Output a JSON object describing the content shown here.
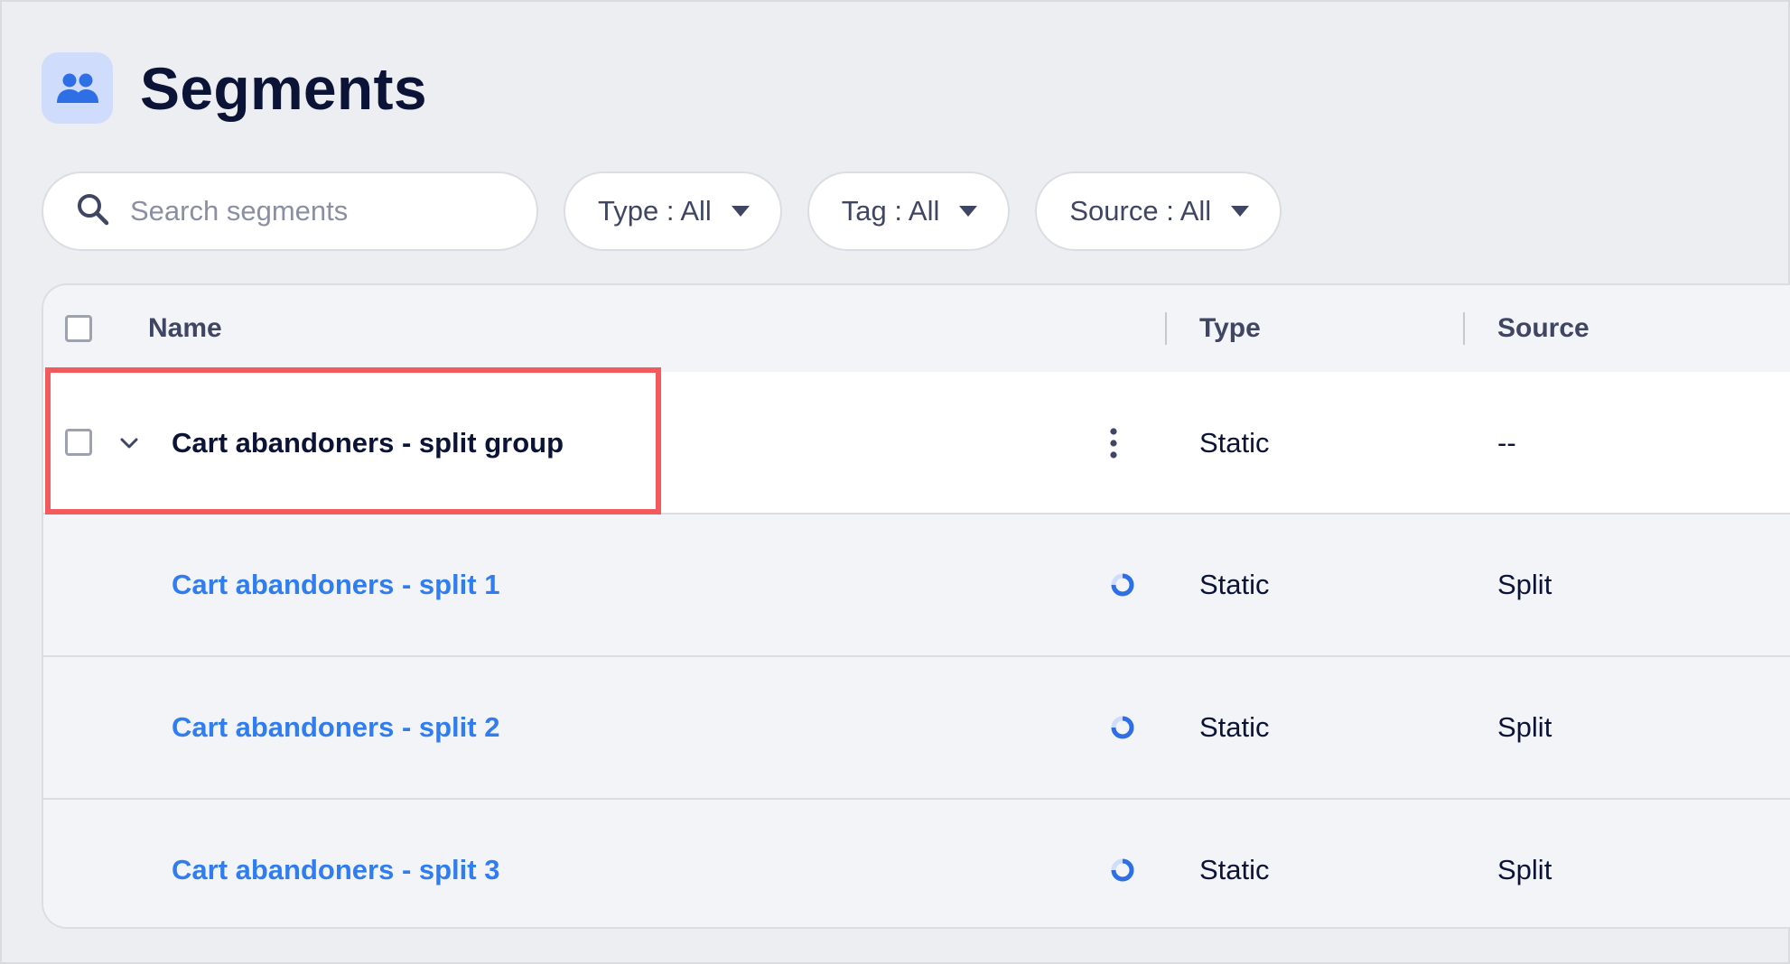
{
  "header": {
    "icon": "users-icon",
    "title": "Segments",
    "icon_bg": "#cfdcfb",
    "icon_color": "#2f6fe6"
  },
  "filters": {
    "search_placeholder": "Search segments",
    "type": {
      "label": "Type : All"
    },
    "tag": {
      "label": "Tag : All"
    },
    "source": {
      "label": "Source : All"
    }
  },
  "table": {
    "columns": {
      "name": "Name",
      "type": "Type",
      "source": "Source"
    },
    "group_row": {
      "name": "Cart abandoners - split group",
      "type": "Static",
      "source": "--"
    },
    "child_rows": [
      {
        "name": "Cart abandoners - split 1",
        "type": "Static",
        "source": "Split"
      },
      {
        "name": "Cart abandoners - split 2",
        "type": "Static",
        "source": "Split"
      },
      {
        "name": "Cart abandoners - split 3",
        "type": "Static",
        "source": "Split"
      }
    ]
  },
  "colors": {
    "accent": "#2f7df0",
    "highlight_border": "#f25a5e"
  }
}
